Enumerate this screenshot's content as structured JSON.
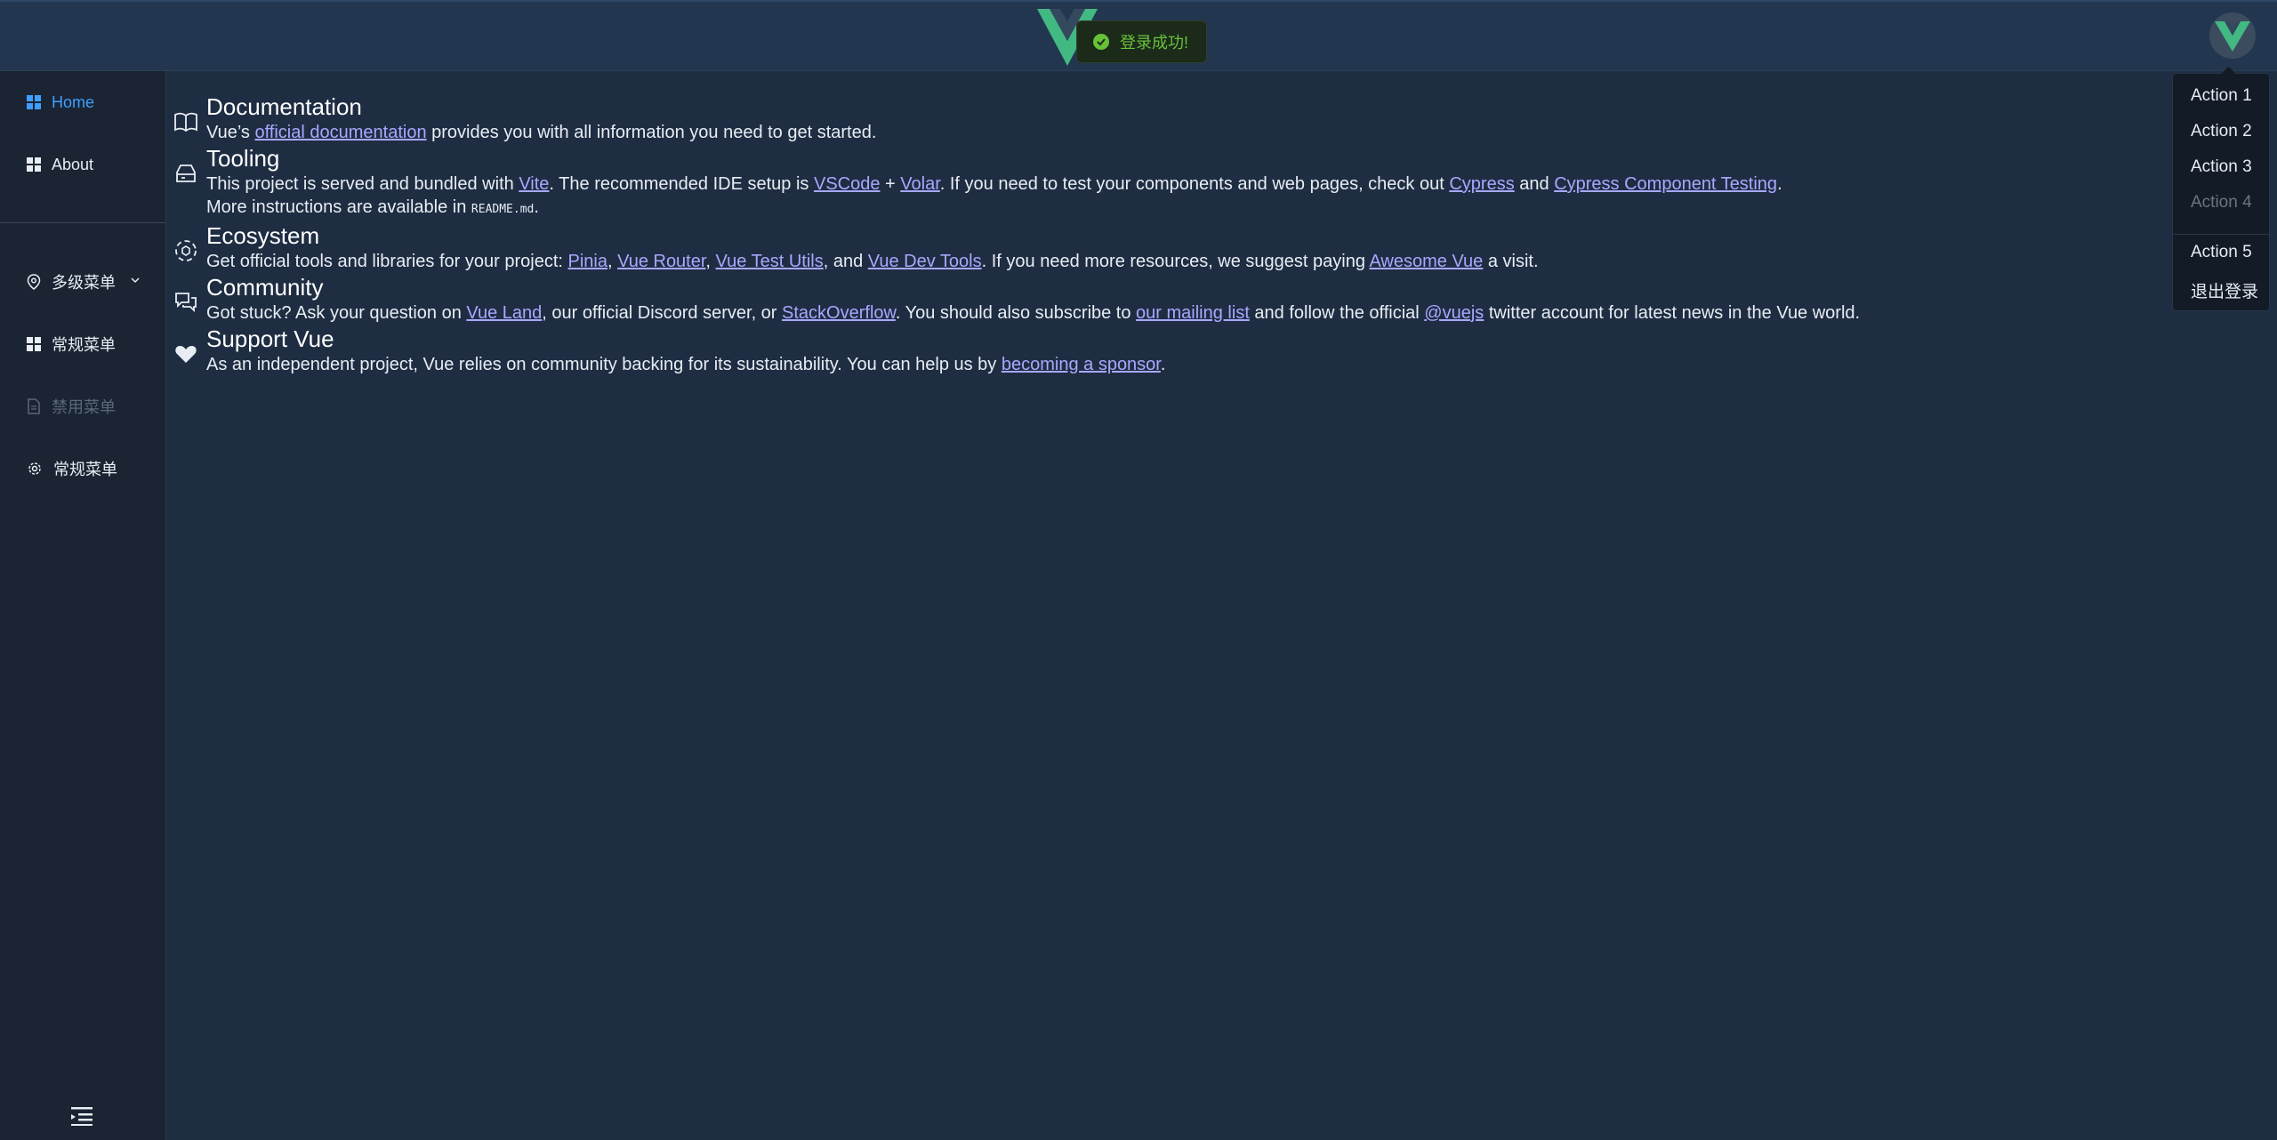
{
  "header": {
    "toast_message": "登录成功!",
    "colors": {
      "vue_green": "#42b883",
      "vue_dark": "#35495e",
      "success": "#67c23a"
    }
  },
  "sidebar": {
    "items": [
      {
        "label": "Home",
        "icon": "grid-icon"
      },
      {
        "label": "About",
        "icon": "grid-icon"
      },
      {
        "label": "多级菜单",
        "icon": "location-pin-icon"
      },
      {
        "label": "常规菜单",
        "icon": "grid-icon"
      },
      {
        "label": "禁用菜单",
        "icon": "document-icon"
      },
      {
        "label": "常规菜单",
        "icon": "gear-icon"
      }
    ]
  },
  "dropdown": {
    "items": [
      "Action 1",
      "Action 2",
      "Action 3",
      "Action 4",
      "Action 5",
      "退出登录"
    ]
  },
  "main": {
    "sections": [
      {
        "title": "Documentation",
        "t1": "Vue’s ",
        "link1": "official documentation",
        "t2": " provides you with all information you need to get started."
      },
      {
        "title": "Tooling",
        "t1": "This project is served and bundled with ",
        "link1": "Vite",
        "t2": ". The recommended IDE setup is ",
        "link2": "VSCode",
        "t3": " + ",
        "link3": "Volar",
        "t4": ". If you need to test your components and web pages, check out ",
        "link4": "Cypress",
        "t5": " and ",
        "link5": "Cypress Component Testing",
        "t6": ".",
        "t7": "More instructions are available in ",
        "code": "README.md",
        "t8": "."
      },
      {
        "title": "Ecosystem",
        "t1": "Get official tools and libraries for your project: ",
        "link1": "Pinia",
        "t2": ", ",
        "link2": "Vue Router",
        "t3": ", ",
        "link3": "Vue Test Utils",
        "t4": ", and ",
        "link4": "Vue Dev Tools",
        "t5": ". If you need more resources, we suggest paying ",
        "link5": "Awesome Vue",
        "t6": " a visit."
      },
      {
        "title": "Community",
        "t1": "Got stuck? Ask your question on ",
        "link1": "Vue Land",
        "t2": ", our official Discord server, or ",
        "link2": "StackOverflow",
        "t3": ". You should also subscribe to ",
        "link3": "our mailing list",
        "t4": " and follow the official ",
        "link4": "@vuejs",
        "t5": " twitter account for latest news in the Vue world."
      },
      {
        "title": "Support Vue",
        "t1": "As an independent project, Vue relies on community backing for its sustainability. You can help us by ",
        "link1": "becoming a sponsor",
        "t2": "."
      }
    ]
  }
}
